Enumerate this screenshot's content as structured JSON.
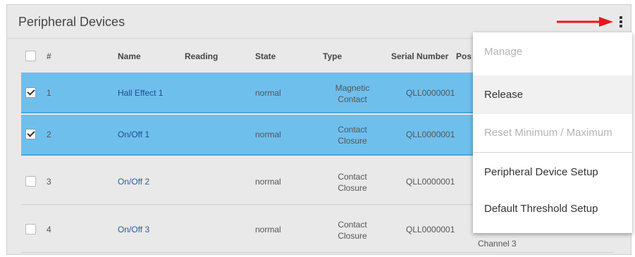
{
  "panel": {
    "title": "Peripheral Devices"
  },
  "table": {
    "headers": {
      "hash": "#",
      "name": "Name",
      "reading": "Reading",
      "state": "State",
      "type": "Type",
      "serial": "Serial Number",
      "position": "Pos"
    },
    "rows": [
      {
        "num": "1",
        "name": "Hall Effect 1",
        "state": "normal",
        "type_line1": "Magnetic",
        "type_line2": "Contact",
        "serial": "QLL0000001",
        "selected": true
      },
      {
        "num": "2",
        "name": "On/Off 1",
        "state": "normal",
        "type_line1": "Contact",
        "type_line2": "Closure",
        "serial": "QLL0000001",
        "selected": true
      },
      {
        "num": "3",
        "name": "On/Off 2",
        "state": "normal",
        "type_line1": "Contact",
        "type_line2": "Closure",
        "serial": "QLL0000001",
        "selected": false
      },
      {
        "num": "4",
        "name": "On/Off 3",
        "state": "normal",
        "type_line1": "Contact",
        "type_line2": "Closure",
        "serial": "QLL0000001",
        "selected": false,
        "channel": "Channel 3"
      }
    ]
  },
  "menu": {
    "items": [
      {
        "label": "Manage",
        "disabled": true
      },
      {
        "label": "Release",
        "disabled": false
      },
      {
        "label": "Reset Minimum / Maximum",
        "disabled": true
      },
      {
        "label": "Peripheral Device Setup",
        "disabled": false
      },
      {
        "label": "Default Threshold Setup",
        "disabled": false
      }
    ]
  },
  "colors": {
    "selected_row": "#6fbfed",
    "arrow": "#e8161b",
    "panel_bg": "#e9e9e9"
  },
  "icons": {
    "menu": "kebab-vertical-icon",
    "arrow": "red-arrow-right-icon"
  }
}
